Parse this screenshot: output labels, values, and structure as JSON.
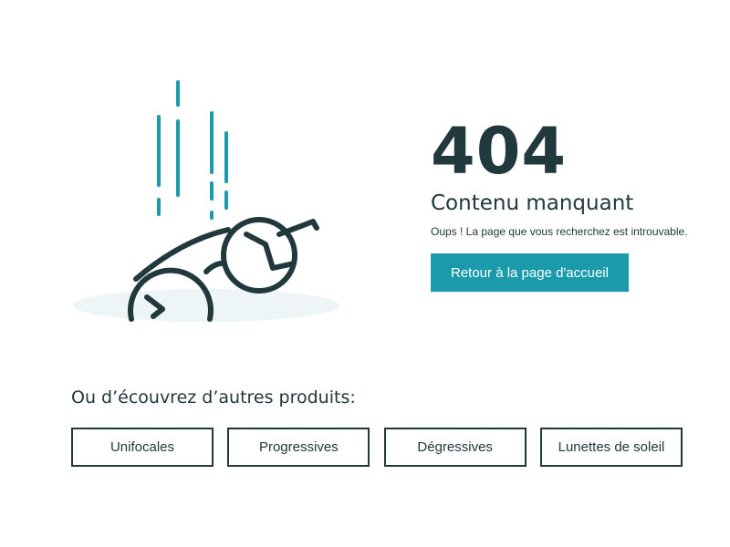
{
  "error": {
    "code": "404",
    "title": "Contenu manquant",
    "message": "Oups ! La page que vous recherchez est introuvable.",
    "home_button_label": "Retour à la page d'accueil"
  },
  "discover": {
    "title": "Ou d’écouvrez d’autres produits:",
    "products": [
      {
        "label": "Unifocales"
      },
      {
        "label": "Progressives"
      },
      {
        "label": "Dégressives"
      },
      {
        "label": "Lunettes de soleil"
      }
    ]
  },
  "illustration": {
    "icon": "falling-glasses-icon"
  },
  "colors": {
    "accent": "#1a9aab",
    "text": "#21393c",
    "shadow": "#eef5f6"
  }
}
